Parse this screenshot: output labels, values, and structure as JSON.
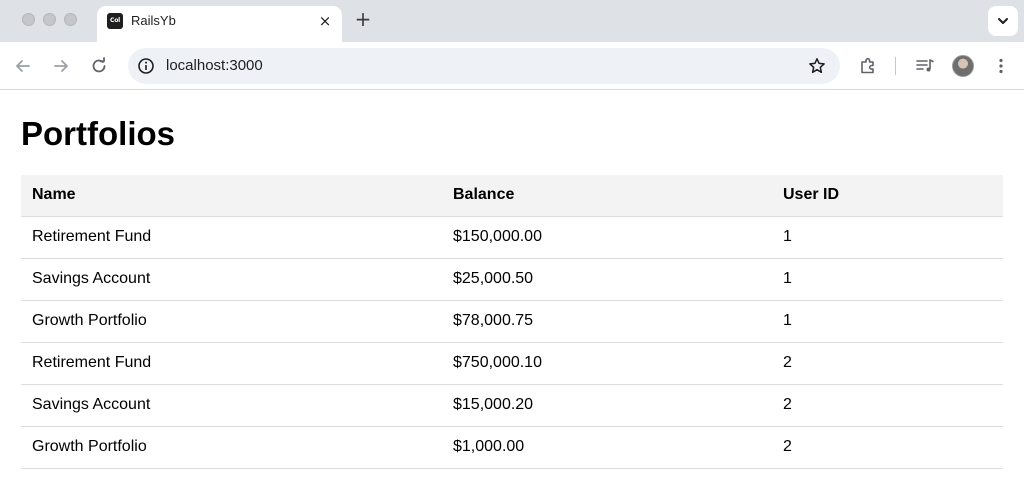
{
  "browser": {
    "tab": {
      "favicon_text": "Col",
      "title": "RailsYb",
      "close_glyph": "×"
    },
    "new_tab_glyph": "+",
    "url": "localhost:3000"
  },
  "page": {
    "title": "Portfolios",
    "table": {
      "headers": {
        "name": "Name",
        "balance": "Balance",
        "user_id": "User ID"
      },
      "rows": [
        {
          "name": "Retirement Fund",
          "balance": "$150,000.00",
          "user_id": "1"
        },
        {
          "name": "Savings Account",
          "balance": "$25,000.50",
          "user_id": "1"
        },
        {
          "name": "Growth Portfolio",
          "balance": "$78,000.75",
          "user_id": "1"
        },
        {
          "name": "Retirement Fund",
          "balance": "$750,000.10",
          "user_id": "2"
        },
        {
          "name": "Savings Account",
          "balance": "$15,000.20",
          "user_id": "2"
        },
        {
          "name": "Growth Portfolio",
          "balance": "$1,000.00",
          "user_id": "2"
        }
      ]
    }
  },
  "colors": {
    "tabstrip": "#dee1e6",
    "omnibox": "#eef1f6",
    "header_row": "#f3f3f3",
    "row_border": "#dcdcdc"
  }
}
